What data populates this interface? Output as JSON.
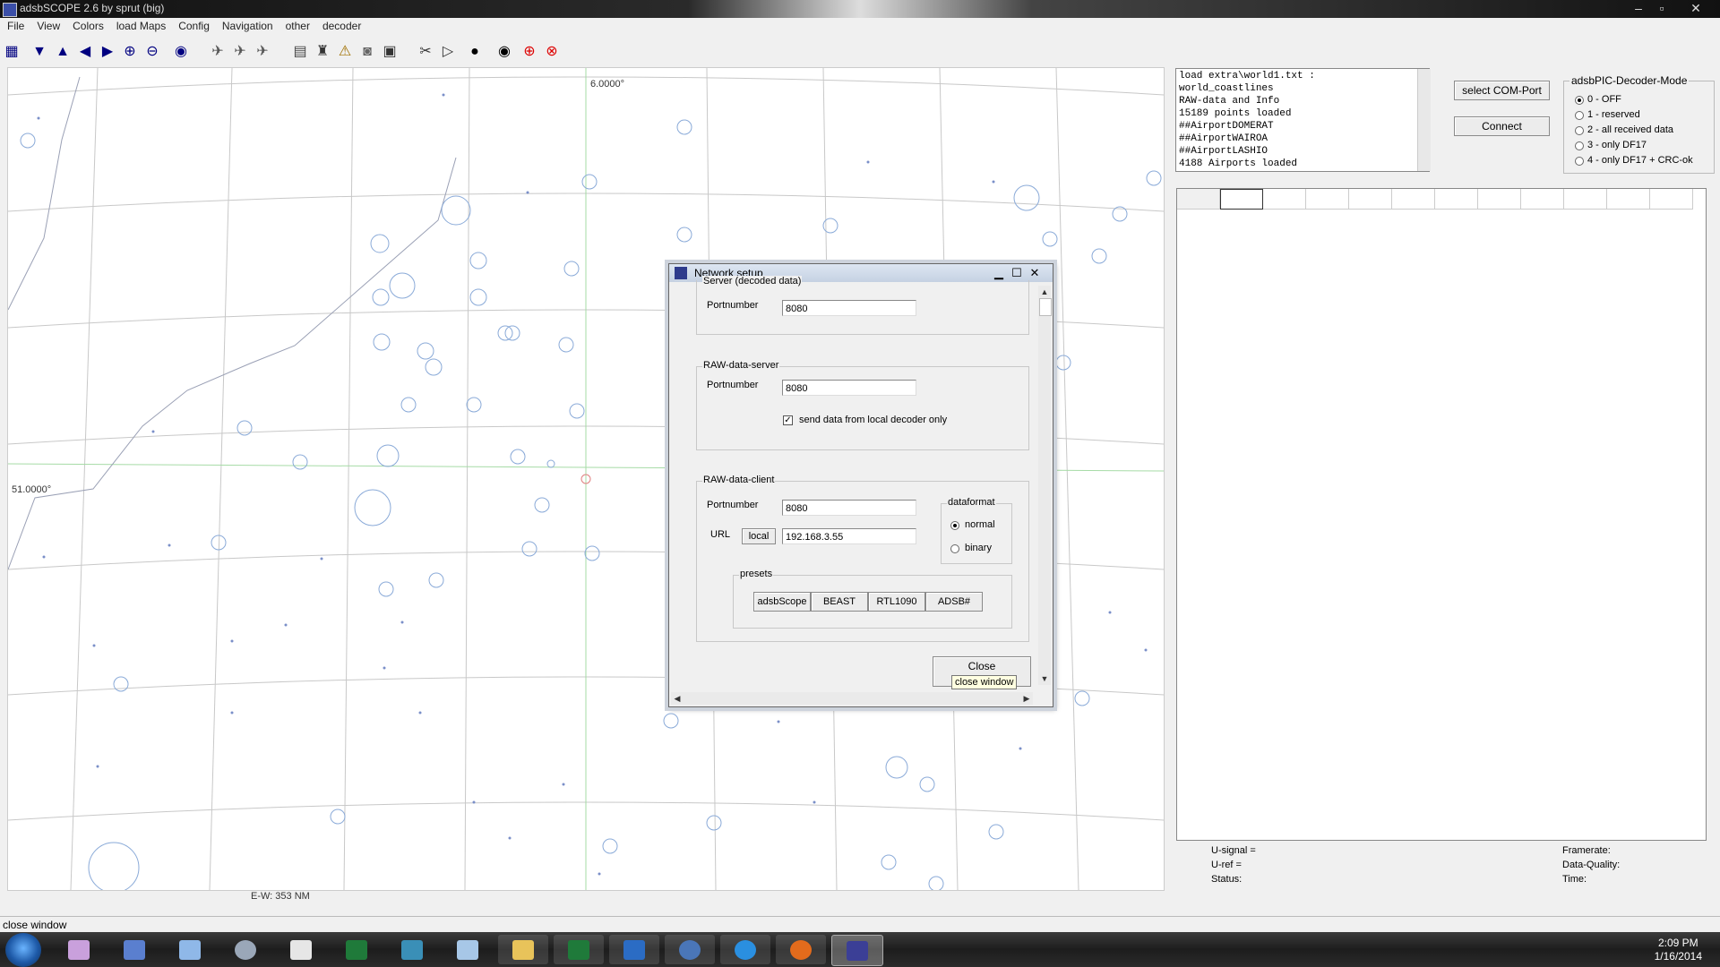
{
  "app": {
    "title": "adsbSCOPE 2.6 by sprut  (big)",
    "window_controls": [
      "–",
      "▫",
      "✕"
    ]
  },
  "menu": [
    "File",
    "View",
    "Colors",
    "load Maps",
    "Config",
    "Navigation",
    "other",
    "decoder"
  ],
  "toolbar_icons": [
    "table-icon",
    "arrow-down-icon",
    "arrow-up-icon",
    "arrow-left-icon",
    "arrow-right-icon",
    "zoom-in-icon",
    "zoom-out-icon",
    "globe-icon",
    "plane-icon",
    "plane-icon",
    "plane-icon",
    "chart-icon",
    "tower-icon",
    "warning-icon",
    "camera-icon",
    "monitor-icon",
    "tools-icon",
    "play-icon",
    "record-icon",
    "record-icon",
    "target-icon",
    "stop-icon"
  ],
  "map": {
    "lon_label": "6.0000°",
    "lat_label": "51.0000°",
    "scale_label": "E-W: 353 NM"
  },
  "console": {
    "lines": [
      "load extra\\world1.txt :",
      "world_coastlines",
      "RAW-data and Info",
      "15189 points loaded",
      "##AirportDOMERAT",
      "##AirportWAIROA",
      "##AirportLASHIO",
      "4188 Airports loaded"
    ]
  },
  "right_buttons": {
    "select_com": "select COM-Port",
    "connect": "Connect"
  },
  "decoder_mode": {
    "title": "adsbPIC-Decoder-Mode",
    "options": [
      "0 - OFF",
      "1 - reserved",
      "2 - all received data",
      "3 - only DF17",
      "4 - only DF17 + CRC-ok"
    ],
    "selected": 0
  },
  "signal_panel": {
    "usignal": "U-signal =",
    "uref": "U-ref =",
    "status": "Status:",
    "framerate": "Framerate:",
    "quality": "Data-Quality:",
    "time": "Time:"
  },
  "dialog": {
    "title": "Network setup",
    "server_legend": "Server (decoded data)",
    "server_port_label": "Portnumber",
    "server_port": "8080",
    "raw_server_legend": "RAW-data-server",
    "raw_server_port_label": "Portnumber",
    "raw_server_port": "8080",
    "local_only_label": "send data from local decoder only",
    "local_only_checked": true,
    "raw_client_legend": "RAW-data-client",
    "raw_client_port_label": "Portnumber",
    "raw_client_port": "8080",
    "url_label": "URL",
    "local_button": "local",
    "url_value": "192.168.3.55",
    "dataformat_legend": "dataformat",
    "dataformat_options": [
      "normal",
      "binary"
    ],
    "dataformat_selected": 0,
    "presets_legend": "presets",
    "presets": [
      "adsbScope",
      "BEAST",
      "RTL1090",
      "ADSB#"
    ],
    "close_button": "Close",
    "close_tooltip": "close window"
  },
  "statusbar": {
    "text": "close window"
  },
  "taskbar": {
    "apps": [
      "visual-studio-icon",
      "network-icon",
      "notepad-icon",
      "chrome-icon",
      "window-icon",
      "excel-icon",
      "fish-icon",
      "feather-icon",
      "folder-icon",
      "excel-icon",
      "outlook-icon",
      "thunderbird-icon",
      "ie-icon",
      "firefox-icon",
      "adsbscope-icon"
    ],
    "time": "2:09 PM",
    "date": "1/16/2014"
  }
}
